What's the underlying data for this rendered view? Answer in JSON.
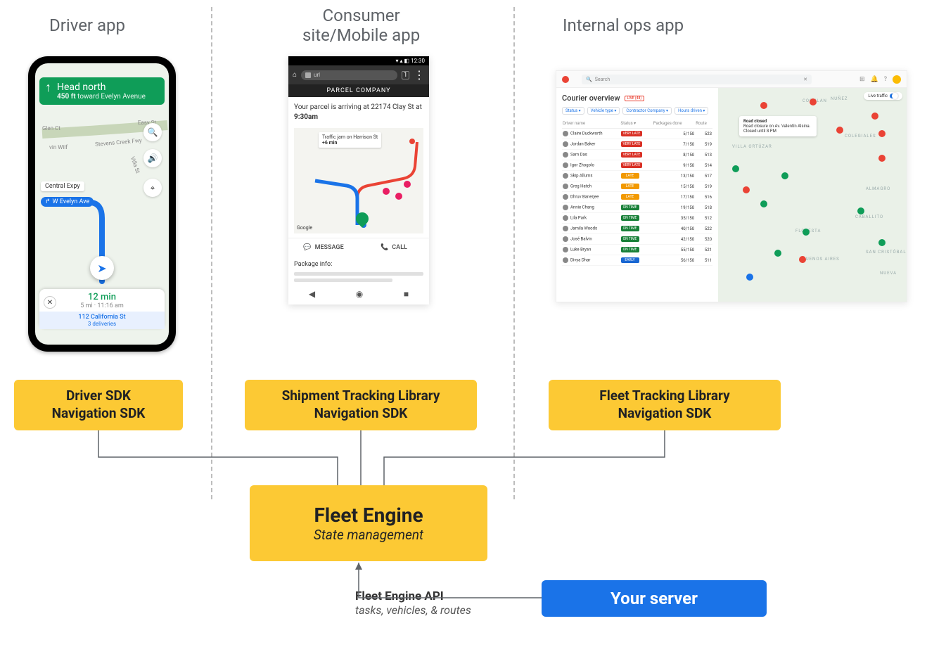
{
  "titles": {
    "driver": "Driver app",
    "consumer": "Consumer\nsite/Mobile app",
    "ops": "Internal ops app"
  },
  "driver_app": {
    "direction_main": "Head north",
    "direction_sub": "toward Evelyn Avenue",
    "distance": "450 ft",
    "street_chip": "W Evelyn Ave",
    "central": "Central Expy",
    "streets": [
      "Glen Ct",
      "Stevens Creek Fwy",
      "Villa St",
      "Easy St",
      "vin Wilf"
    ],
    "eta_time": "12 min",
    "eta_sub": "5 mi · 11:16 am",
    "eta_addr": "112 California St",
    "eta_deliveries": "3 deliveries"
  },
  "consumer_app": {
    "status_time": "12:30",
    "url_text": "url",
    "company": "PARCEL COMPANY",
    "msg_line": "Your parcel is arriving at 22174 Clay St at",
    "msg_time": "9:30am",
    "traffic_line1": "Traffic jam on Harrison St",
    "traffic_line2": "+6 min",
    "google_logo": "Google",
    "btn_message": "MESSAGE",
    "btn_call": "CALL",
    "pkg_info": "Package info:"
  },
  "ops_app": {
    "search_placeholder": "Search",
    "title": "Courier overview",
    "live": "LIVE (48)",
    "filters": [
      "Status",
      "Vehicle type",
      "Contractor Company",
      "Hours driven"
    ],
    "th": [
      "Driver name",
      "Status",
      "Packages done",
      "Route"
    ],
    "status_colors": {
      "VERY LATE": "#d93025",
      "LATE": "#f29900",
      "ON TIME": "#188038",
      "EARLY": "#1967d2"
    },
    "rows": [
      {
        "name": "Claire Duckworth",
        "status": "VERY LATE",
        "pkg": "5/150",
        "route": "523"
      },
      {
        "name": "Jordan Baker",
        "status": "VERY LATE",
        "pkg": "7/150",
        "route": "519"
      },
      {
        "name": "Sam Das",
        "status": "VERY LATE",
        "pkg": "8/150",
        "route": "513"
      },
      {
        "name": "Igor Zhogolo",
        "status": "VERY LATE",
        "pkg": "9/150",
        "route": "514"
      },
      {
        "name": "Skip Allums",
        "status": "LATE",
        "pkg": "13/150",
        "route": "517"
      },
      {
        "name": "Greg Hatch",
        "status": "LATE",
        "pkg": "15/150",
        "route": "519"
      },
      {
        "name": "Dhruv Banerjee",
        "status": "LATE",
        "pkg": "17/150",
        "route": "516"
      },
      {
        "name": "Annie Chang",
        "status": "ON TIME",
        "pkg": "19/150",
        "route": "518"
      },
      {
        "name": "Lila Park",
        "status": "ON TIME",
        "pkg": "35/150",
        "route": "512"
      },
      {
        "name": "Jamila Woods",
        "status": "ON TIME",
        "pkg": "40/150",
        "route": "522"
      },
      {
        "name": "José Balvin",
        "status": "ON TIME",
        "pkg": "42/150",
        "route": "520"
      },
      {
        "name": "Luke Bryan",
        "status": "ON TIME",
        "pkg": "55/150",
        "route": "521"
      },
      {
        "name": "Divya Dhar",
        "status": "EARLY",
        "pkg": "56/150",
        "route": "511"
      }
    ],
    "live_traffic": "Live traffic",
    "road_closed_t": "Road closed",
    "road_closed_d": "Road closure on Av. Valentín Alsina. Closed until 8 PM",
    "areas": [
      "NUÑEZ",
      "COLEGIALES",
      "VILLA ORTÚZAR",
      "COGHLAN",
      "ALMAGRO",
      "CABALLITO",
      "FLORESTA",
      "BUENOS AIRES",
      "SAN CRISTÓBAL",
      "NUEVA"
    ]
  },
  "boxes": {
    "driver_sdk_l1": "Driver SDK",
    "driver_sdk_l2": "Navigation SDK",
    "ship_l1": "Shipment Tracking Library",
    "ship_l2": "Navigation SDK",
    "fleet_lib_l1": "Fleet Tracking Library",
    "fleet_lib_l2": "Navigation SDK",
    "engine_t1": "Fleet Engine",
    "engine_t2": "State management",
    "server": "Your server",
    "api_t1": "Fleet Engine API",
    "api_t2": "tasks, vehicles, & routes"
  }
}
